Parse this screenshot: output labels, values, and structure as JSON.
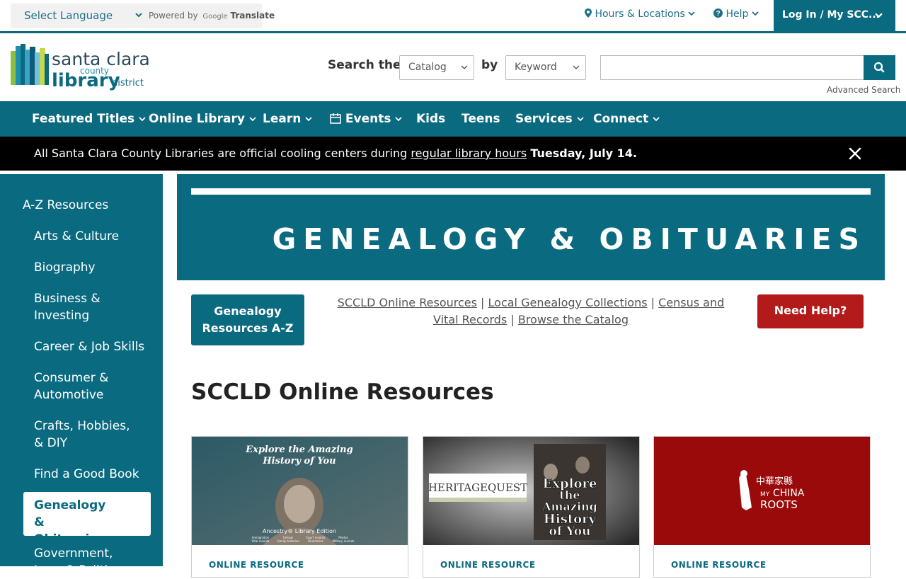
{
  "top_bar": {
    "language": "Select Language",
    "powered_by": "Powered by",
    "google": "Google",
    "translate": "Translate",
    "hours": "Hours & Locations",
    "help": "Help",
    "login": "Log In / My SCC..."
  },
  "logo": {
    "line1": "santa clara",
    "line2": "county",
    "line3": "library",
    "line4": "district"
  },
  "search": {
    "label": "Search the",
    "scope": "Catalog",
    "by": "by",
    "field": "Keyword",
    "query": "",
    "advanced": "Advanced Search"
  },
  "nav": {
    "items": [
      {
        "label": "Featured Titles"
      },
      {
        "label": "Online Library"
      },
      {
        "label": "Learn"
      },
      {
        "label": "Events"
      },
      {
        "label": "Kids"
      },
      {
        "label": "Teens"
      },
      {
        "label": "Services"
      },
      {
        "label": "Connect"
      }
    ]
  },
  "alert": {
    "text_before": "All Santa Clara County Libraries are official cooling centers during ",
    "link": "regular library hours",
    "strong": "Tuesday, July 14."
  },
  "sidebar": {
    "items": [
      {
        "label": "A-Z Resources"
      },
      {
        "label": "Arts & Culture"
      },
      {
        "label": "Biography"
      },
      {
        "label": "Business & Investing"
      },
      {
        "label": "Career & Job Skills"
      },
      {
        "label": "Consumer & Automotive"
      },
      {
        "label": "Crafts, Hobbies, & DIY"
      },
      {
        "label": "Find a Good Book"
      },
      {
        "label": "Genealogy & Obituaries"
      },
      {
        "label": "Government, Law, & Politics"
      }
    ]
  },
  "banner": {
    "title": "GENEALOGY & OBITUARIES"
  },
  "actions": {
    "genealogy_btn": "Genealogy Resources A-Z",
    "link1": "SCCLD Online Resources",
    "link2": "Local Genealogy Collections",
    "link3": "Census and Vital Records",
    "link4": "Browse the Catalog",
    "separator": "|",
    "help_btn": "Need Help?"
  },
  "section": {
    "title": "SCCLD Online Resources"
  },
  "cards": [
    {
      "headline1": "Explore the Amazing",
      "headline2": "History of You",
      "brand": "Ancestry® Library Edition",
      "captions": [
        "Immigration",
        "Census",
        "Court records",
        "Photos",
        "Vital records",
        "Family histories",
        "Directories",
        "Military records"
      ],
      "kind": "ONLINE RESOURCE"
    },
    {
      "brand": "HERITAGEQUEST",
      "lines": [
        "Explore",
        "the",
        "Amazing",
        "History",
        "of You"
      ],
      "kind": "ONLINE RESOURCE"
    },
    {
      "chinese": "中華家縣",
      "my": "MY",
      "china": "CHINA",
      "roots": "ROOTS",
      "kind": "ONLINE RESOURCE"
    }
  ],
  "colors": {
    "primary": "#0a6a80",
    "help": "#b31b1b",
    "alert_bg": "#000000",
    "logo_green": "#8dbf3e"
  }
}
